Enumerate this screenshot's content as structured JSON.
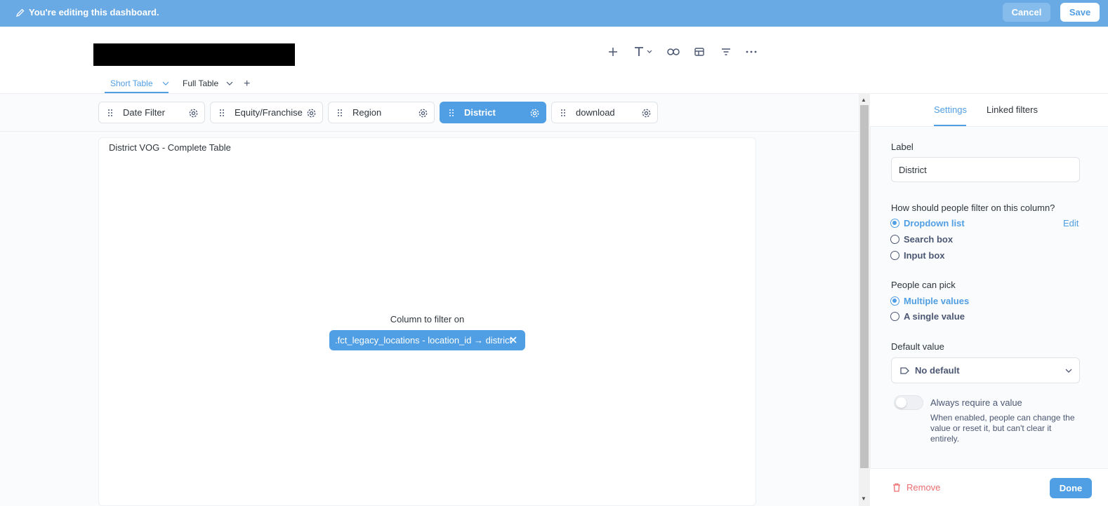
{
  "edit_bar": {
    "message": "You're editing this dashboard.",
    "cancel_label": "Cancel",
    "save_label": "Save",
    "color": "#6aaae4"
  },
  "toolbar": {
    "icons": [
      "plus-icon",
      "text-icon",
      "link-icon",
      "section-icon",
      "filter-icon",
      "more-icon"
    ]
  },
  "dashboard_tabs": [
    {
      "label": "Short Table",
      "active": true
    },
    {
      "label": "Full Table",
      "active": false
    }
  ],
  "filters": [
    {
      "label": "Date Filter",
      "active": false
    },
    {
      "label": "Equity/Franchise",
      "active": false
    },
    {
      "label": "Region",
      "active": false
    },
    {
      "label": "District",
      "active": true
    },
    {
      "label": "download",
      "active": false
    }
  ],
  "card": {
    "title": "District VOG - Complete Table",
    "column_to_filter_label": "Column to filter on",
    "column_mapping": ".fct_legacy_locations - location_id → district"
  },
  "panel": {
    "tabs": [
      {
        "label": "Settings",
        "active": true
      },
      {
        "label": "Linked filters",
        "active": false
      }
    ],
    "label_heading": "Label",
    "label_value": "District",
    "filter_type_heading": "How should people filter on this column?",
    "filter_type_options": [
      {
        "label": "Dropdown list",
        "selected": true
      },
      {
        "label": "Search box",
        "selected": false
      },
      {
        "label": "Input box",
        "selected": false
      }
    ],
    "edit_label": "Edit",
    "pick_heading": "People can pick",
    "pick_options": [
      {
        "label": "Multiple values",
        "selected": true
      },
      {
        "label": "A single value",
        "selected": false
      }
    ],
    "default_heading": "Default value",
    "default_value": "No default",
    "require_label": "Always require a value",
    "require_enabled": false,
    "require_description": "When enabled, people can change the value or reset it, but can't clear it entirely.",
    "remove_label": "Remove",
    "done_label": "Done"
  },
  "colors": {
    "brand": "#509ee3",
    "danger": "#ed6e6e",
    "text": "#4c5773"
  }
}
